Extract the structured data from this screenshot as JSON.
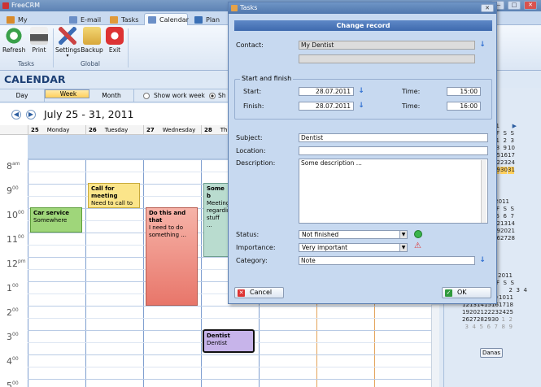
{
  "app": {
    "title": "FreeCRM"
  },
  "tabs": [
    {
      "label": "My Organizer",
      "color": "#d88a2a"
    },
    {
      "label": "E-mail",
      "color": "#6b8fc7"
    },
    {
      "label": "Tasks",
      "color": "#e09a3a"
    },
    {
      "label": "Calendar",
      "color": "#6b8fc7"
    },
    {
      "label": "Plan",
      "color": "#3a6fb5"
    }
  ],
  "ribbon": {
    "buttons": [
      {
        "label": "Refresh",
        "icon": "refresh-icon",
        "color": "#3aa04a"
      },
      {
        "label": "Print",
        "icon": "printer-icon",
        "color": "#555555"
      },
      {
        "label": "Settings",
        "icon": "settings-tools-icon",
        "color": "#c44"
      },
      {
        "label": "Backup",
        "icon": "backup-icon",
        "color": "#e1b63a"
      },
      {
        "label": "Exit",
        "icon": "power-icon",
        "color": "#d33"
      }
    ],
    "groups": [
      "Tasks",
      "Global"
    ]
  },
  "calendar": {
    "header": "CALENDAR",
    "views": [
      "Day",
      "Week",
      "Month"
    ],
    "selected_view": "Week",
    "options": [
      "Show work week",
      "Sh"
    ],
    "date_range": "July 25 - 31, 2011",
    "days": [
      {
        "num": "25",
        "name": "Monday"
      },
      {
        "num": "26",
        "name": "Tuesday"
      },
      {
        "num": "27",
        "name": "Wednesday"
      },
      {
        "num": "28",
        "name": "Th"
      }
    ],
    "hours": [
      {
        "h": "8",
        "sfx": "am"
      },
      {
        "h": "9",
        "sfx": "00"
      },
      {
        "h": "10",
        "sfx": "00"
      },
      {
        "h": "11",
        "sfx": "00"
      },
      {
        "h": "12",
        "sfx": "pm"
      },
      {
        "h": "1",
        "sfx": "00"
      },
      {
        "h": "2",
        "sfx": "00"
      },
      {
        "h": "3",
        "sfx": "00"
      },
      {
        "h": "4",
        "sfx": "00"
      },
      {
        "h": "5",
        "sfx": "00"
      }
    ],
    "events": [
      {
        "title": "Car service",
        "text": "Somewhere",
        "color": "#9fd67a"
      },
      {
        "title": "Call for meeting",
        "text": "Need to call to arrange a",
        "color": "#fbe58a"
      },
      {
        "title": "Do this and that",
        "text": "I need to do something ...",
        "color": "#ee8a7c"
      },
      {
        "title": "Some b",
        "text": "Meeting regardin stuff ...",
        "color": "#b9dccf"
      },
      {
        "title": "Dentist",
        "text": "Dentist",
        "color": "#c7b4ea"
      }
    ]
  },
  "minical": {
    "month1_label": "1",
    "headers": [
      "F",
      "S",
      "S"
    ],
    "m1": [
      [
        "1",
        "2",
        "3"
      ],
      [
        "8",
        "9",
        "10"
      ],
      [
        "15",
        "16",
        "17"
      ],
      [
        "22",
        "23",
        "24"
      ],
      [
        "29",
        "30",
        "31"
      ]
    ],
    "month2_label": "2011",
    "m2": [
      [
        "5",
        "6",
        "7"
      ],
      [
        "12",
        "13",
        "14"
      ],
      [
        "19",
        "20",
        "21"
      ],
      [
        "26",
        "27",
        "28"
      ]
    ],
    "month3_label": "r, 2011",
    "m3": [
      [
        "",
        "",
        "",
        "",
        "",
        "",
        "2",
        "3",
        "4"
      ],
      [
        "5",
        "6",
        "7",
        "8",
        "9",
        "10",
        "11"
      ],
      [
        "12",
        "13",
        "14",
        "15",
        "16",
        "17",
        "18"
      ],
      [
        "19",
        "20",
        "21",
        "22",
        "23",
        "24",
        "25"
      ],
      [
        "26",
        "27",
        "28",
        "29",
        "30",
        "1",
        "2"
      ],
      [
        "3",
        "4",
        "5",
        "6",
        "7",
        "8",
        "9"
      ]
    ],
    "today_button": "Danas"
  },
  "dialog": {
    "title": "Tasks",
    "banner": "Change record",
    "contact_label": "Contact:",
    "contact_value": "My Dentist",
    "contact_value2": "",
    "start_finish_label": "Start and finish",
    "start_label": "Start:",
    "start_date": "28.07.2011",
    "start_time_label": "Time:",
    "start_time": "15:00",
    "finish_label": "Finish:",
    "finish_date": "28.07.2011",
    "finish_time_label": "Time:",
    "finish_time": "16:00",
    "subject_label": "Subject:",
    "subject_value": "Dentist",
    "location_label": "Location:",
    "location_value": "",
    "description_label": "Description:",
    "description_value": "Some description ...",
    "status_label": "Status:",
    "status_value": "Not finished",
    "importance_label": "Importance:",
    "importance_value": "Very important",
    "category_label": "Category:",
    "category_value": "Note",
    "cancel_label": "Cancel",
    "ok_label": "OK"
  }
}
